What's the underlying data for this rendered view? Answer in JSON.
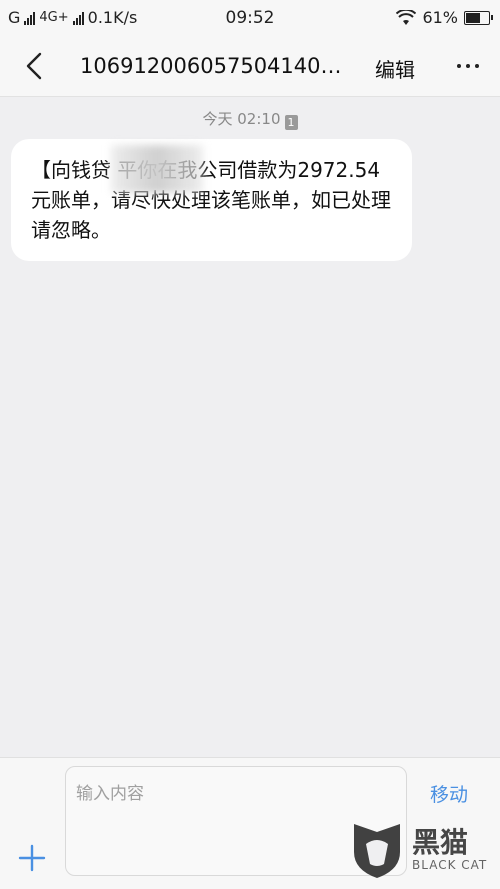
{
  "status_bar": {
    "carrier1": "G",
    "carrier2": "4G+",
    "speed": "0.1K/s",
    "time": "09:52",
    "battery": "61%"
  },
  "header": {
    "title": "106912006057504140…",
    "edit_label": "编辑"
  },
  "conversation": {
    "timestamp": "今天 02:10",
    "sim_badge": "1",
    "message": "【向钱贷    平你在我公司借款为2972.54元账单，请尽快处理该笔账单，如已处理请忽略。"
  },
  "composer": {
    "placeholder": "输入内容",
    "move_label": "移动"
  },
  "watermark": {
    "cn": "黑猫",
    "en": "BLACK CAT"
  },
  "colors": {
    "accent": "#4a90e2",
    "background": "#efeff1",
    "bubble": "#ffffff"
  }
}
